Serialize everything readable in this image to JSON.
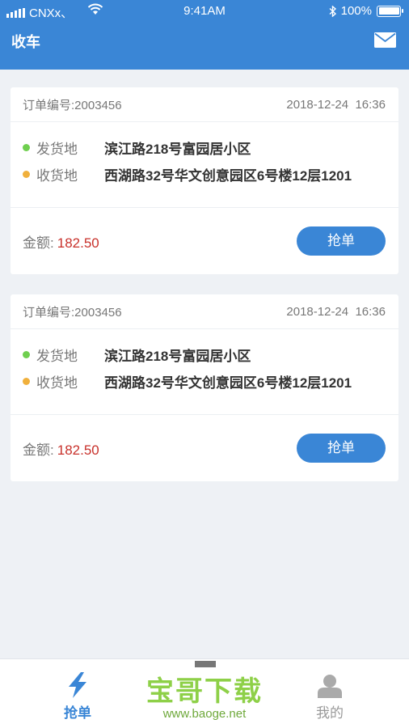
{
  "status_bar": {
    "carrier": "CNXx、",
    "time": "9:41AM",
    "battery": "100%"
  },
  "header": {
    "title": "收车",
    "mail_icon": "mail-icon"
  },
  "orders": [
    {
      "order_label": "订单编号:",
      "order_no": "2003456",
      "datetime": "2018-12-24  16:36",
      "from_label": "发货地",
      "from_addr": "滨江路218号富园居小区",
      "to_label": "收货地",
      "to_addr": "西湖路32号华文创意园区6号楼12层1201",
      "amount_label": "金额:",
      "amount": "182.50",
      "button_label": "抢单"
    },
    {
      "order_label": "订单编号:",
      "order_no": "2003456",
      "datetime": "2018-12-24  16:36",
      "from_label": "发货地",
      "from_addr": "滨江路218号富园居小区",
      "to_label": "收货地",
      "to_addr": "西湖路32号华文创意园区6号楼12层1201",
      "amount_label": "金额:",
      "amount": "182.50",
      "button_label": "抢单"
    }
  ],
  "tabbar": {
    "tabs": [
      {
        "label": "抢单",
        "icon": "lightning-icon",
        "active": true
      },
      {
        "label": "我的",
        "icon": "user-icon",
        "active": false
      }
    ]
  },
  "watermark": {
    "title": "宝哥下载",
    "url": "www.baoge.net"
  },
  "colors": {
    "primary": "#3a86d6",
    "amount": "#c8312b",
    "from_dot": "#6fcf4f",
    "to_dot": "#f0b03c"
  }
}
